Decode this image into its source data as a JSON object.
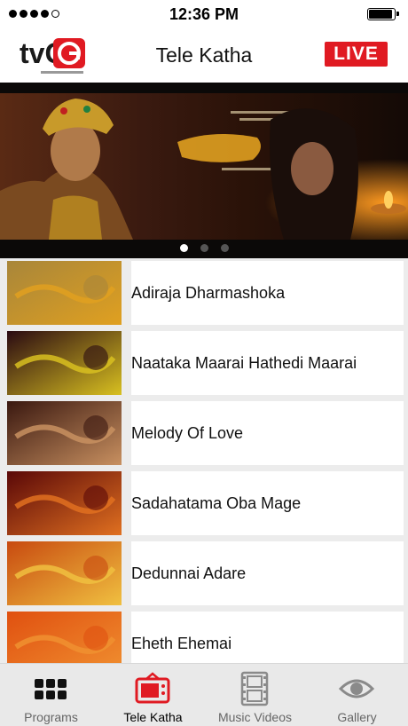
{
  "status_bar": {
    "time": "12:36 PM",
    "battery_level": 0.85
  },
  "header": {
    "logo_text": "tvG",
    "title": "Tele Katha",
    "live_label": "LIVE"
  },
  "banner": {
    "image": "featured-drama-banner",
    "page_count": 3,
    "active_page": 1
  },
  "dramas": [
    {
      "title": "Adiraja Dharmashoka",
      "thumb_colors": [
        "#a8863a",
        "#e0a020"
      ]
    },
    {
      "title": "Naataka Maarai Hathedi Maarai",
      "thumb_colors": [
        "#2a0a12",
        "#d8c020"
      ]
    },
    {
      "title": "Melody Of Love",
      "thumb_colors": [
        "#3a1810",
        "#c89060"
      ]
    },
    {
      "title": "Sadahatama Oba Mage",
      "thumb_colors": [
        "#5a0808",
        "#e07020"
      ]
    },
    {
      "title": "Dedunnai Adare",
      "thumb_colors": [
        "#c84a10",
        "#f0c040"
      ]
    },
    {
      "title": "Eheth Ehemai",
      "thumb_colors": [
        "#e05010",
        "#f09030"
      ]
    }
  ],
  "tabs": [
    {
      "label": "Programs",
      "icon": "grid-icon",
      "active": false
    },
    {
      "label": "Tele Katha",
      "icon": "tv-icon",
      "active": true
    },
    {
      "label": "Music Videos",
      "icon": "film-icon",
      "active": false
    },
    {
      "label": "Gallery",
      "icon": "eye-icon",
      "active": false
    }
  ],
  "colors": {
    "accent": "#e01a22",
    "tab_inactive": "#8a8a8a"
  }
}
